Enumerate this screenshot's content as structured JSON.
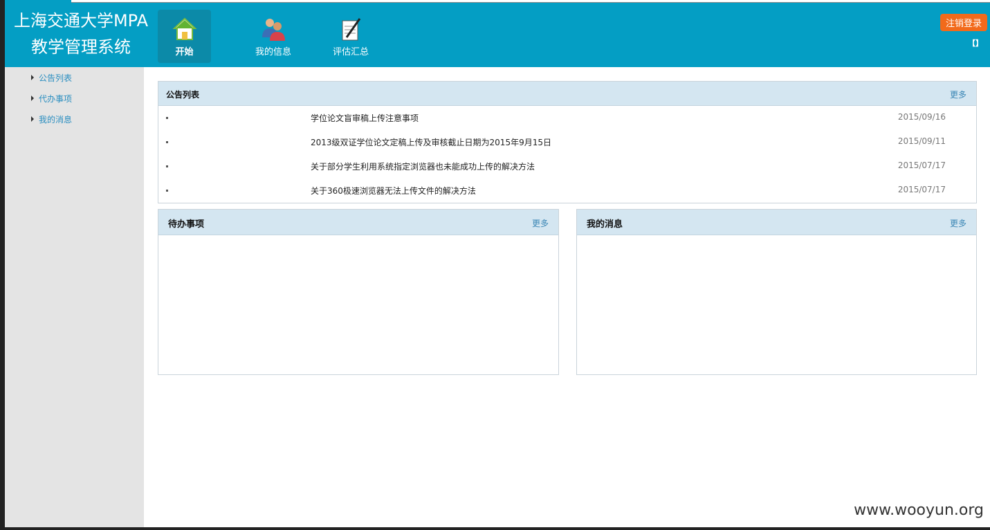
{
  "header": {
    "logo_line1": "上海交通大学MPA",
    "logo_line2": "教学管理系统",
    "nav": [
      {
        "label": "开始",
        "icon": "home-icon",
        "active": true
      },
      {
        "label": "我的信息",
        "icon": "users-icon",
        "active": false
      },
      {
        "label": "评估汇总",
        "icon": "notepad-icon",
        "active": false
      }
    ],
    "logout_label": "注销登录",
    "bracket_text": "【】"
  },
  "sidebar": {
    "items": [
      {
        "label": "公告列表"
      },
      {
        "label": "代办事项"
      },
      {
        "label": "我的消息"
      }
    ]
  },
  "notice_panel": {
    "title": "公告列表",
    "more": "更多",
    "rows": [
      {
        "title": "学位论文盲审稿上传注意事项",
        "date": "2015/09/16"
      },
      {
        "title": "2013级双证学位论文定稿上传及审核截止日期为2015年9月15日",
        "date": "2015/09/11"
      },
      {
        "title": "关于部分学生利用系统指定浏览器也未能成功上传的解决方法",
        "date": "2015/07/17"
      },
      {
        "title": "关于360极速浏览器无法上传文件的解决方法",
        "date": "2015/07/17"
      }
    ]
  },
  "todo_panel": {
    "title": "待办事项",
    "more": "更多"
  },
  "msg_panel": {
    "title": "我的消息",
    "more": "更多"
  },
  "watermark": "www.wooyun.org",
  "colors": {
    "header": "#049ec4",
    "logout": "#f26a1b",
    "panel_header": "#d4e6f1",
    "link": "#2a8ec0"
  }
}
